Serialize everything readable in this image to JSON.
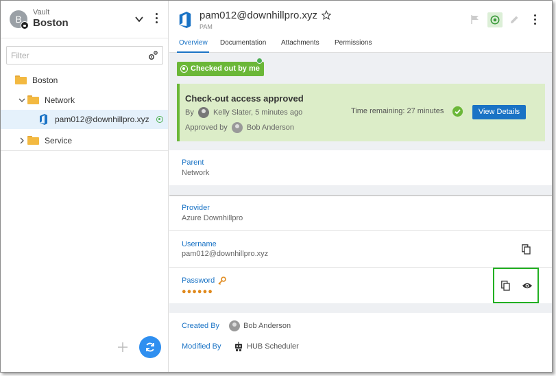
{
  "sidebar": {
    "vault_label": "Vault",
    "vault_name": "Boston",
    "avatar_initial": "B",
    "filter_placeholder": "Filter",
    "tree": [
      {
        "label": "Boston"
      },
      {
        "label": "Network"
      },
      {
        "label": "pam012@downhillpro.xyz"
      },
      {
        "label": "Service"
      }
    ]
  },
  "entry": {
    "title": "pam012@downhillpro.xyz",
    "subtitle": "PAM",
    "tabs": [
      "Overview",
      "Documentation",
      "Attachments",
      "Permissions"
    ]
  },
  "badge": {
    "label": "Checked out by me"
  },
  "approval": {
    "title": "Check-out access approved",
    "by_prefix": "By",
    "by_text": "Kelly Slater, 5 minutes ago",
    "approved_prefix": "Approved by",
    "approved_name": "Bob Anderson",
    "time_remaining": "Time remaining: 27 minutes",
    "view_details": "View Details"
  },
  "fields": {
    "parent_label": "Parent",
    "parent_value": "Network",
    "provider_label": "Provider",
    "provider_value": "Azure Downhillpro",
    "username_label": "Username",
    "username_value": "pam012@downhillpro.xyz",
    "password_label": "Password",
    "password_value": "●●●●●●",
    "created_label": "Created By",
    "created_value": "Bob Anderson",
    "modified_label": "Modified By",
    "modified_value": "HUB Scheduler"
  },
  "colors": {
    "accent": "#1a73c5",
    "success": "#6bb738",
    "highlight": "#22b022",
    "password": "#e08a1e"
  }
}
